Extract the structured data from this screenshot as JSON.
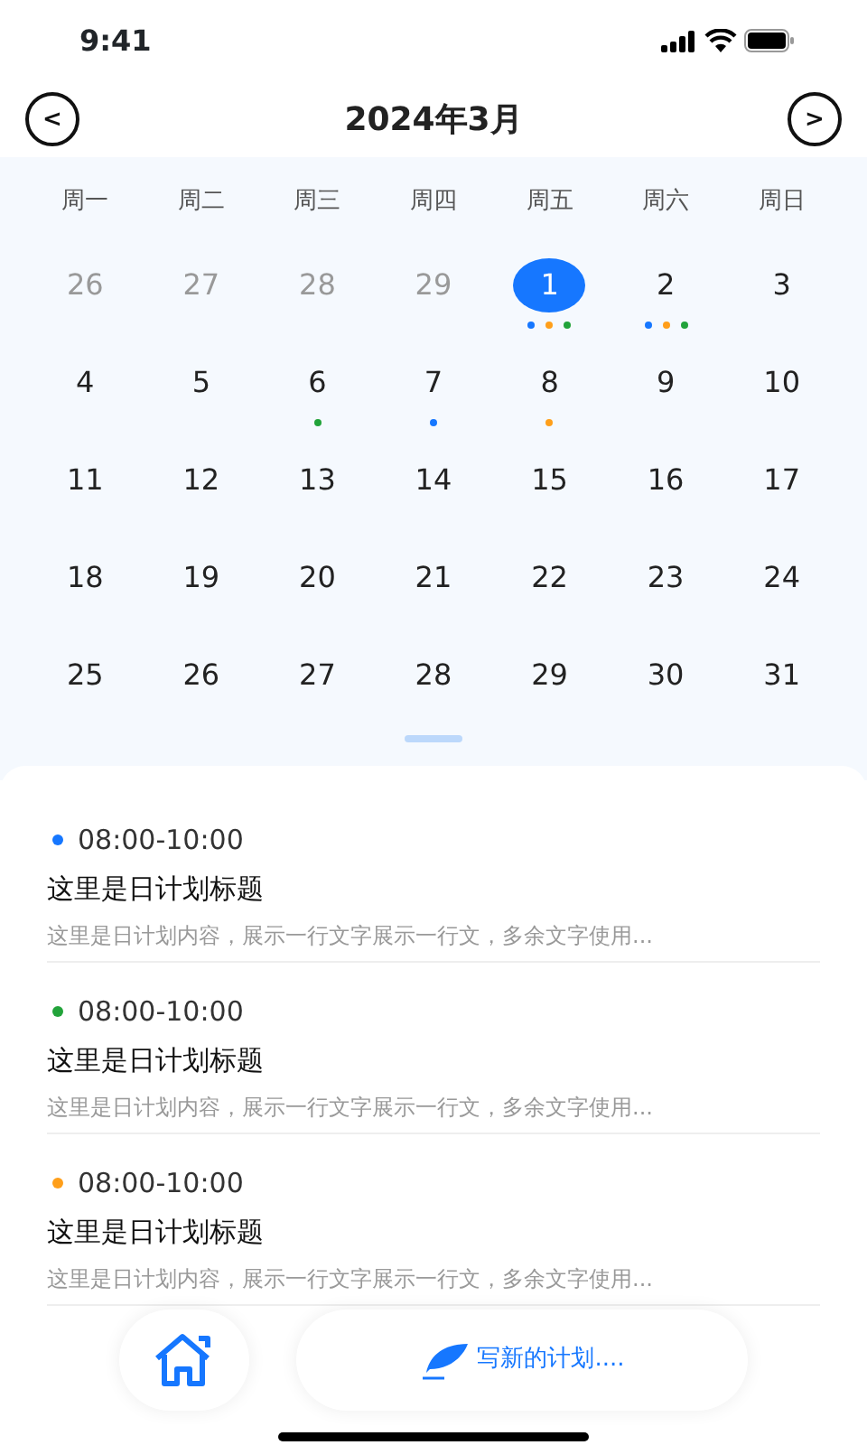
{
  "status_bar": {
    "time": "9:41"
  },
  "header": {
    "prev": "<",
    "title": "2024年3月",
    "next": ">"
  },
  "weekdays": [
    "周一",
    "周二",
    "周三",
    "周四",
    "周五",
    "周六",
    "周日"
  ],
  "weeks": [
    [
      {
        "day": "26",
        "muted": true,
        "selected": false
      },
      {
        "day": "27",
        "muted": true,
        "selected": false
      },
      {
        "day": "28",
        "muted": true,
        "selected": false
      },
      {
        "day": "29",
        "muted": true,
        "selected": false
      },
      {
        "day": "1",
        "muted": false,
        "selected": true,
        "dots": [
          {
            "color": "#1677ff"
          },
          {
            "color": "#ff9f1a"
          },
          {
            "color": "#22a33a"
          }
        ]
      },
      {
        "day": "2",
        "muted": false,
        "selected": false,
        "dots": [
          {
            "color": "#1677ff"
          },
          {
            "color": "#ff9f1a"
          },
          {
            "color": "#22a33a"
          }
        ]
      },
      {
        "day": "3",
        "muted": false,
        "selected": false
      }
    ],
    [
      {
        "day": "4",
        "muted": false,
        "selected": false
      },
      {
        "day": "5",
        "muted": false,
        "selected": false
      },
      {
        "day": "6",
        "muted": false,
        "selected": false,
        "dots": [
          {
            "color": "#22a33a"
          }
        ]
      },
      {
        "day": "7",
        "muted": false,
        "selected": false,
        "dots": [
          {
            "color": "#1677ff"
          }
        ]
      },
      {
        "day": "8",
        "muted": false,
        "selected": false,
        "dots": [
          {
            "color": "#ff9f1a"
          }
        ]
      },
      {
        "day": "9",
        "muted": false,
        "selected": false
      },
      {
        "day": "10",
        "muted": false,
        "selected": false
      }
    ],
    [
      {
        "day": "11",
        "muted": false,
        "selected": false
      },
      {
        "day": "12",
        "muted": false,
        "selected": false
      },
      {
        "day": "13",
        "muted": false,
        "selected": false
      },
      {
        "day": "14",
        "muted": false,
        "selected": false
      },
      {
        "day": "15",
        "muted": false,
        "selected": false
      },
      {
        "day": "16",
        "muted": false,
        "selected": false
      },
      {
        "day": "17",
        "muted": false,
        "selected": false
      }
    ],
    [
      {
        "day": "18",
        "muted": false,
        "selected": false
      },
      {
        "day": "19",
        "muted": false,
        "selected": false
      },
      {
        "day": "20",
        "muted": false,
        "selected": false
      },
      {
        "day": "21",
        "muted": false,
        "selected": false
      },
      {
        "day": "22",
        "muted": false,
        "selected": false
      },
      {
        "day": "23",
        "muted": false,
        "selected": false
      },
      {
        "day": "24",
        "muted": false,
        "selected": false
      }
    ],
    [
      {
        "day": "25",
        "muted": false,
        "selected": false
      },
      {
        "day": "26",
        "muted": false,
        "selected": false
      },
      {
        "day": "27",
        "muted": false,
        "selected": false
      },
      {
        "day": "28",
        "muted": false,
        "selected": false
      },
      {
        "day": "29",
        "muted": false,
        "selected": false
      },
      {
        "day": "30",
        "muted": false,
        "selected": false
      },
      {
        "day": "31",
        "muted": false,
        "selected": false
      }
    ]
  ],
  "plans": [
    {
      "color": "#1677ff",
      "time": "08:00-10:00",
      "title": "这里是日计划标题",
      "content": "这里是日计划内容，展示一行文字展示一行文，多余文字使用..."
    },
    {
      "color": "#22a33a",
      "time": "08:00-10:00",
      "title": "这里是日计划标题",
      "content": "这里是日计划内容，展示一行文字展示一行文，多余文字使用..."
    },
    {
      "color": "#ff9f1a",
      "time": "08:00-10:00",
      "title": "这里是日计划标题",
      "content": "这里是日计划内容，展示一行文字展示一行文，多余文字使用..."
    }
  ],
  "bottom_bar": {
    "write_button": "写新的计划...."
  }
}
